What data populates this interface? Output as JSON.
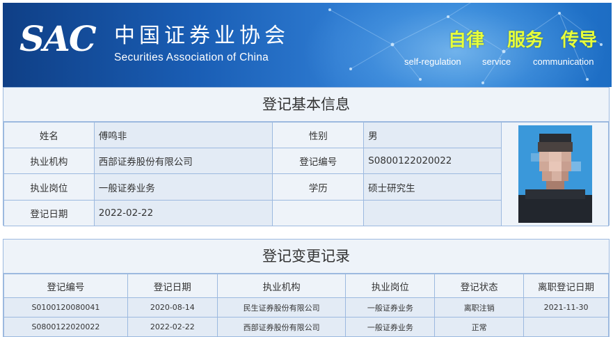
{
  "header": {
    "logo_abbr": "SAC",
    "logo_cn": "中国证券业协会",
    "logo_en": "Securities Association of China",
    "slogans": [
      {
        "cn": "自律",
        "en": "self-regulation"
      },
      {
        "cn": "服务",
        "en": "service"
      },
      {
        "cn": "传导",
        "en": "communication"
      }
    ]
  },
  "basic_info": {
    "title": "登记基本信息",
    "rows": [
      {
        "k1": "姓名",
        "v1": "傅鸣非",
        "k2": "性别",
        "v2": "男"
      },
      {
        "k1": "执业机构",
        "v1": "西部证券股份有限公司",
        "k2": "登记编号",
        "v2": "S0800122020022"
      },
      {
        "k1": "执业岗位",
        "v1": "一般证券业务",
        "k2": "学历",
        "v2": "硕士研究生"
      },
      {
        "k1": "登记日期",
        "v1": "2022-02-22",
        "k2": "",
        "v2": ""
      }
    ]
  },
  "change_history": {
    "title": "登记变更记录",
    "columns": [
      "登记编号",
      "登记日期",
      "执业机构",
      "执业岗位",
      "登记状态",
      "离职登记日期"
    ],
    "rows": [
      [
        "S0100120080041",
        "2020-08-14",
        "民生证券股份有限公司",
        "一般证券业务",
        "离职注销",
        "2021-11-30"
      ],
      [
        "S0800122020022",
        "2022-02-22",
        "西部证券股份有限公司",
        "一般证券业务",
        "正常",
        ""
      ]
    ]
  },
  "colors": {
    "border": "#9cb9df",
    "cell_label_bg": "#eef3f9",
    "cell_value_bg": "#e3ebf5",
    "banner_blue": "#1a5eb5",
    "slogan_yellow": "#e8ff3a"
  }
}
